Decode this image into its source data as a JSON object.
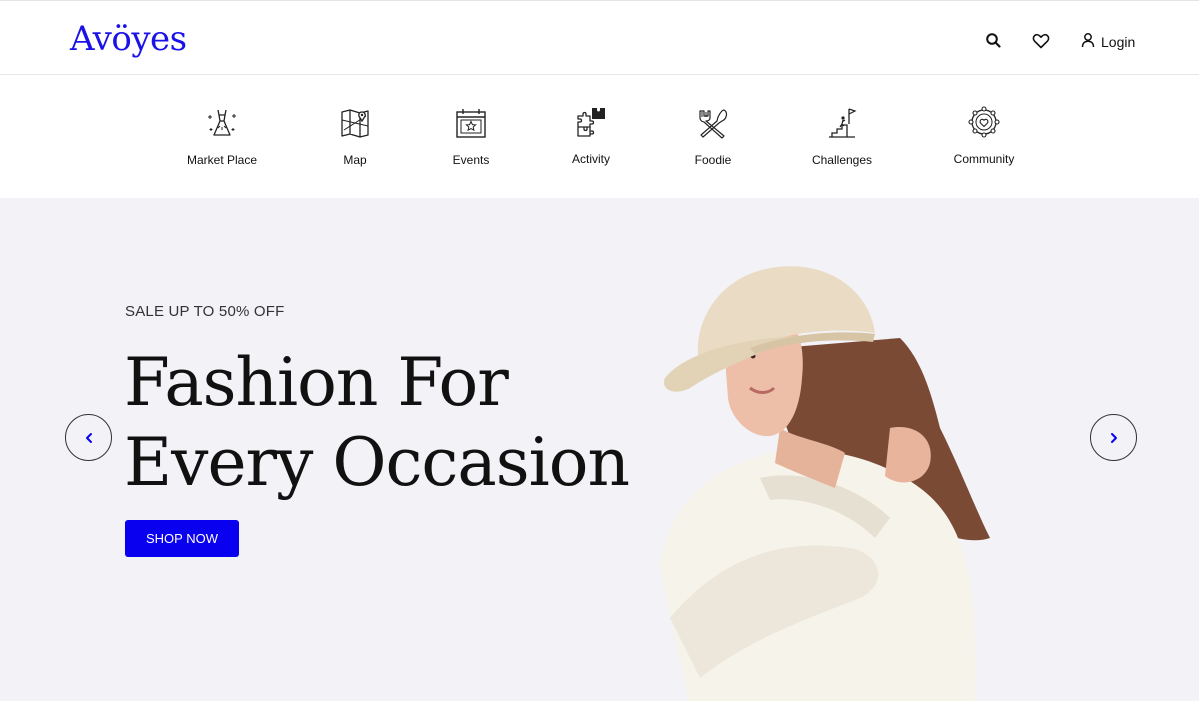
{
  "brand": {
    "logo": "Avöyes"
  },
  "header": {
    "login_label": "Login",
    "icons": [
      "search-icon",
      "heart-icon",
      "user-icon"
    ]
  },
  "categories": [
    {
      "label": "Market Place",
      "icon": "dress-icon"
    },
    {
      "label": "Map",
      "icon": "map-icon"
    },
    {
      "label": "Events",
      "icon": "calendar-icon"
    },
    {
      "label": "Activity",
      "icon": "puzzle-icon"
    },
    {
      "label": "Foodie",
      "icon": "fork-knife-icon"
    },
    {
      "label": "Challenges",
      "icon": "climb-flag-icon"
    },
    {
      "label": "Community",
      "icon": "community-heart-icon"
    }
  ],
  "hero": {
    "sale_text": "SALE UP TO 50% OFF",
    "headline_line1": "Fashion For",
    "headline_line2": "Every Occasion",
    "cta_label": "SHOP NOW",
    "accent_color": "#0a00f0",
    "background_color": "#f2f2f7"
  }
}
